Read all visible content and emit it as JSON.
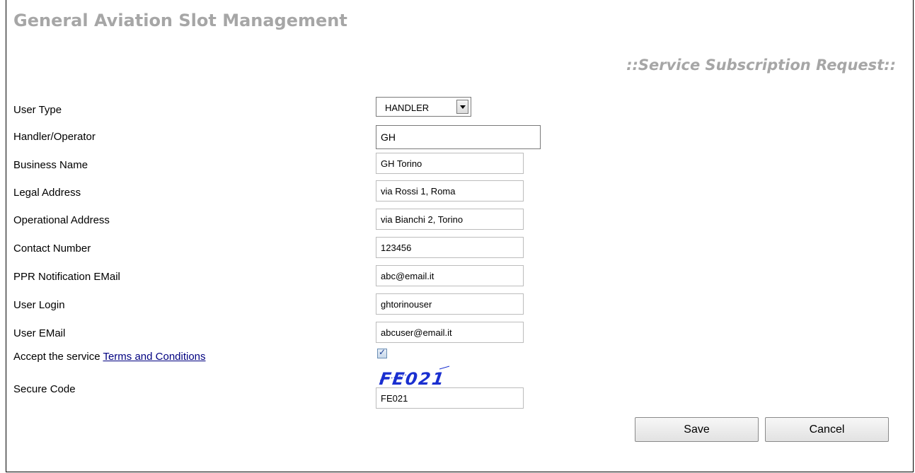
{
  "header": {
    "app_title": "General Aviation Slot Management",
    "page_subtitle": "::Service Subscription Request::"
  },
  "form": {
    "user_type": {
      "label": "User Type",
      "value": "HANDLER"
    },
    "handler_operator": {
      "label": "Handler/Operator",
      "value": "GH"
    },
    "business_name": {
      "label": "Business Name",
      "value": "GH Torino"
    },
    "legal_address": {
      "label": "Legal Address",
      "value": "via Rossi 1, Roma"
    },
    "operational_address": {
      "label": "Operational Address",
      "value": "via Bianchi 2, Torino"
    },
    "contact_number": {
      "label": "Contact Number",
      "value": "123456"
    },
    "ppr_email": {
      "label": "PPR Notification EMail",
      "value": "abc@email.it"
    },
    "user_login": {
      "label": "User Login",
      "value": "ghtorinouser"
    },
    "user_email": {
      "label": "User EMail",
      "value": "abcuser@email.it"
    },
    "terms": {
      "label_prefix": "Accept the service ",
      "link_text": "Terms and Conditions",
      "checked": true
    },
    "captcha": {
      "text": "FE021"
    },
    "secure_code": {
      "label": "Secure Code",
      "value": "FE021"
    }
  },
  "actions": {
    "save_label": "Save",
    "cancel_label": "Cancel"
  },
  "colors": {
    "title_gray": "#a6a6a6",
    "link_navy": "#000080",
    "captcha_blue": "#1a2fd0"
  }
}
